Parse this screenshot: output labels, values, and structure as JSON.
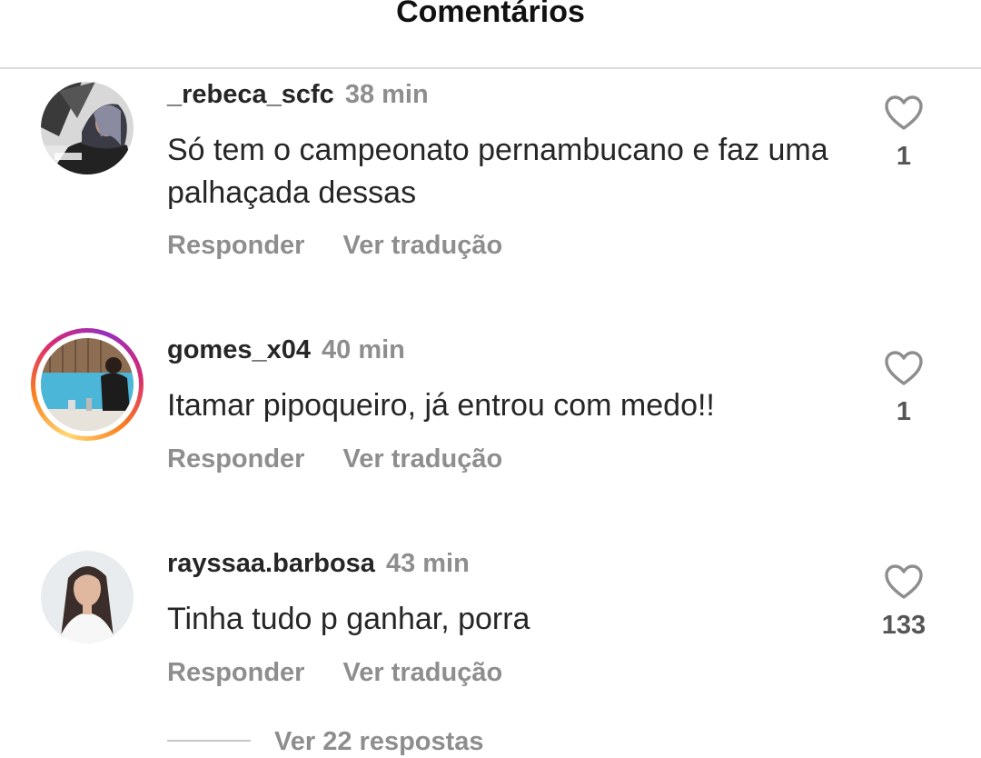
{
  "header": {
    "title": "Comentários"
  },
  "comments": [
    {
      "username": "_rebeca_scfc",
      "time": "38 min",
      "text": "Só tem o campeonato pernambucano e faz uma palhaçada dessas",
      "reply_label": "Responder",
      "translate_label": "Ver tradução",
      "likes": "1",
      "avatar_icon": "user-photo",
      "has_story_ring": false
    },
    {
      "username": "gomes_x04",
      "time": "40 min",
      "text": "Itamar pipoqueiro, já entrou com medo!!",
      "reply_label": "Responder",
      "translate_label": "Ver tradução",
      "likes": "1",
      "avatar_icon": "user-photo",
      "has_story_ring": true
    },
    {
      "username": "rayssaa.barbosa",
      "time": "43 min",
      "text": "Tinha tudo p ganhar, porra",
      "reply_label": "Responder",
      "translate_label": "Ver tradução",
      "likes": "133",
      "avatar_icon": "user-photo",
      "has_story_ring": false
    }
  ],
  "replies": {
    "label": "Ver 22 respostas"
  },
  "icons": {
    "like": "heart-outline-icon"
  },
  "colors": {
    "text": "#262626",
    "secondary": "#8e8e8e",
    "divider": "#dbdbdb",
    "story_ring_start": "#feda75",
    "story_ring_end": "#962fbf"
  }
}
